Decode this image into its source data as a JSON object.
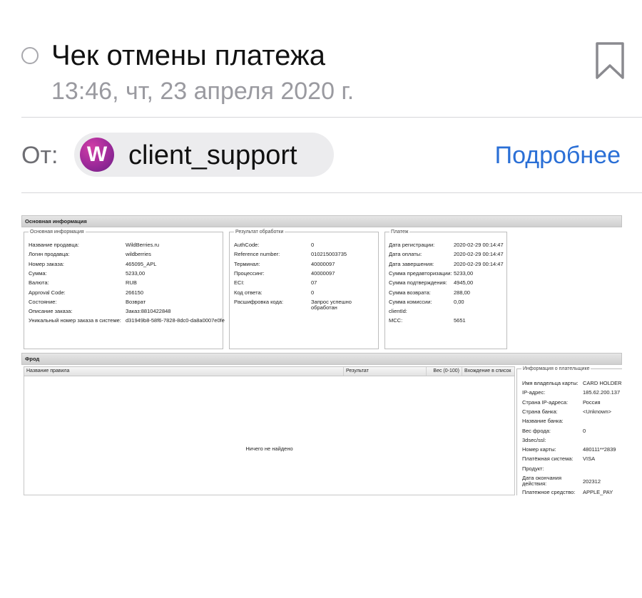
{
  "header": {
    "title": "Чек отмены платежа",
    "date": "13:46, чт, 23 апреля 2020 г."
  },
  "sender": {
    "from_label": "От:",
    "avatar_letter": "W",
    "name": "client_support",
    "more_link": "Подробнее"
  },
  "report": {
    "main_section_title": "Основная информация",
    "basic": {
      "legend": "Основная информация",
      "rows": [
        {
          "label": "Название продавца:",
          "value": "WildBerries.ru"
        },
        {
          "label": "Логин продавца:",
          "value": "wildberries"
        },
        {
          "label": "Номер заказа:",
          "value": "465095_APL"
        },
        {
          "label": "Сумма:",
          "value": "5233,00"
        },
        {
          "label": "Валюта:",
          "value": "RUB"
        },
        {
          "label": "Approval Code:",
          "value": "266150"
        },
        {
          "label": "Состояние:",
          "value": "Возврат"
        },
        {
          "label": "Описание заказа:",
          "value": "Заказ:8810422848"
        },
        {
          "label": "Уникальный номер заказа в системе:",
          "value": "d31949b8-58f6-7828-8dc0-da8a0007e0fe"
        }
      ]
    },
    "processing": {
      "legend": "Результат обработки",
      "rows": [
        {
          "label": "AuthCode:",
          "value": "0"
        },
        {
          "label": "Reference number:",
          "value": "010215003735"
        },
        {
          "label": "Терминал:",
          "value": "40000097"
        },
        {
          "label": "Процессинг:",
          "value": "40000097"
        },
        {
          "label": "ECI:",
          "value": "07"
        },
        {
          "label": "Код ответа:",
          "value": "0"
        },
        {
          "label": "Расшифровка кода:",
          "value": "Запрос успешно",
          "value2": "обработан"
        }
      ]
    },
    "payment": {
      "legend": "Платеж",
      "rows": [
        {
          "label": "Дата регистрации:",
          "value": "2020-02-29 00:14:47"
        },
        {
          "label": "Дата оплаты:",
          "value": "2020-02-29 00:14:47"
        },
        {
          "label": "Дата завершения:",
          "value": "2020-02-29 00:14:47"
        },
        {
          "label": "Сумма предавторизации:",
          "value": "5233,00"
        },
        {
          "label": "Сумма подтверждения:",
          "value": "4945,00"
        },
        {
          "label": "Сумма возврата:",
          "value": "288,00"
        },
        {
          "label": "Сумма комиссии:",
          "value": "0,00"
        },
        {
          "label": "clientId:",
          "value": ""
        },
        {
          "label": "MCC:",
          "value": "5651"
        }
      ]
    },
    "fraud": {
      "section_title": "Фрод",
      "columns": [
        "Название правила",
        "Результат",
        "Вес (0-100)",
        "Вхождение в список"
      ],
      "empty_message": "Ничего не найдено"
    },
    "payer": {
      "legend": "Информация о плательщике",
      "rows": [
        {
          "label": "Имя владельца карты:",
          "value": "CARD HOLDER"
        },
        {
          "label": "IP-адрес:",
          "value": "185.62.200.137"
        },
        {
          "label": "Страна IP-адреса:",
          "value": "Россия"
        },
        {
          "label": "Страна банка:",
          "value": "<Unknown>"
        },
        {
          "label": "Название банка:",
          "value": ""
        },
        {
          "label": "Вес фрода:",
          "value": "0"
        },
        {
          "label": "3dsec/ssl:",
          "value": ""
        },
        {
          "label": "Номер карты:",
          "value": "480111**2839"
        },
        {
          "label": "Платёжная система:",
          "value": "VISA"
        },
        {
          "label": "Продукт:",
          "value": ""
        },
        {
          "label": "Дата окончания",
          "label2": "действия:",
          "value": "202312"
        },
        {
          "label": "Платежное средство:",
          "value": "APPLE_PAY"
        }
      ]
    }
  }
}
